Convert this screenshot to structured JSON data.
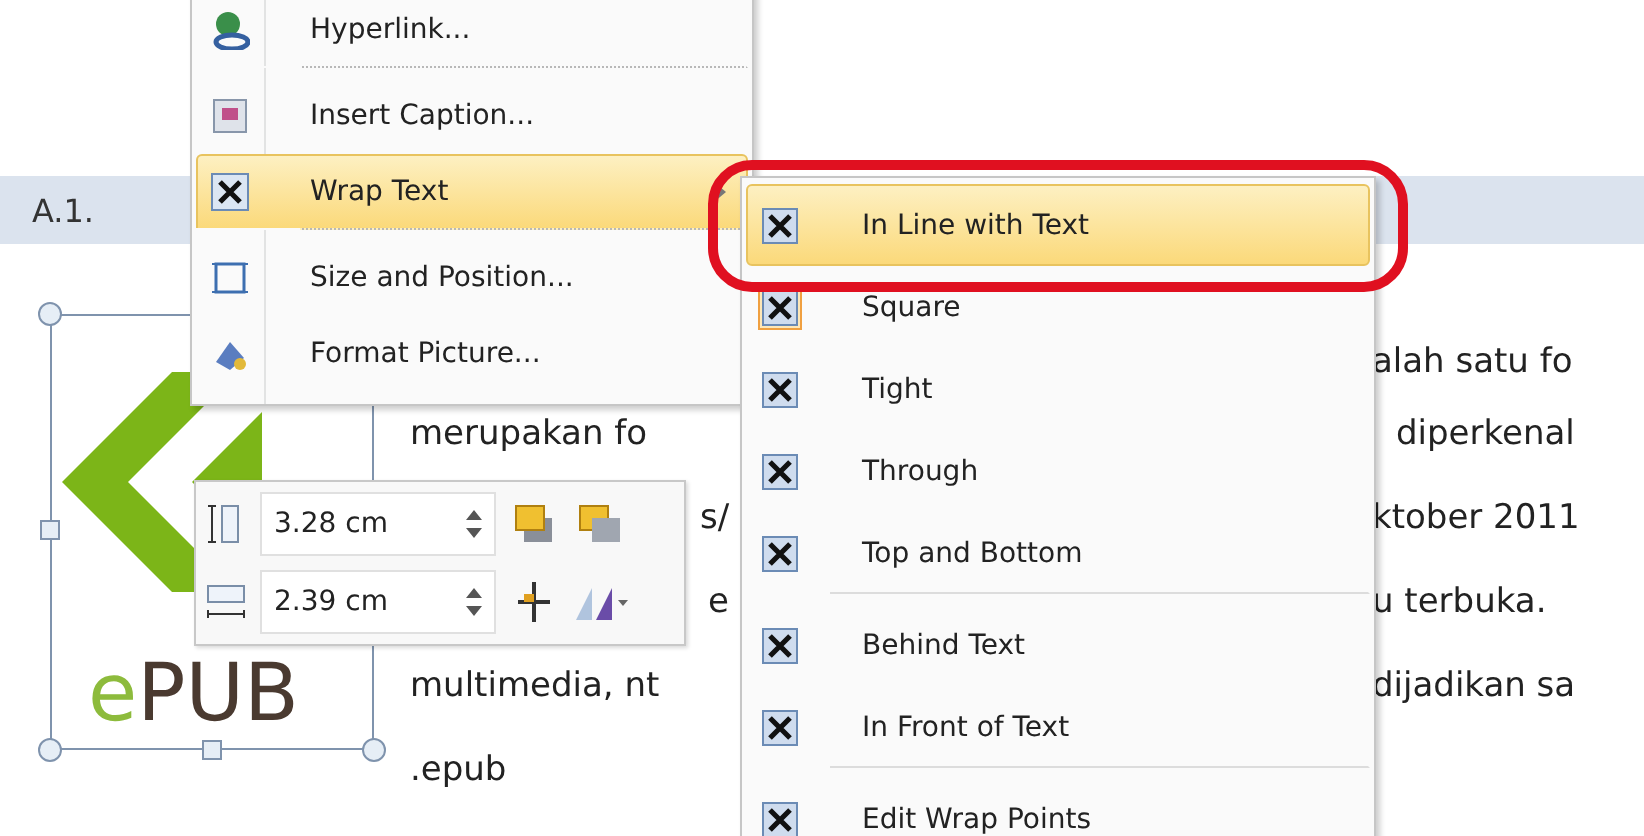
{
  "document": {
    "heading": "A.1.",
    "fragments": [
      {
        "text": "alah satu fo"
      },
      {
        "text": "merupakan fo"
      },
      {
        "text": "diperkenal"
      },
      {
        "text": "s/"
      },
      {
        "text": "ktober 2011"
      },
      {
        "text": "e"
      },
      {
        "text": "u terbuka."
      },
      {
        "text": "multimedia, nt"
      },
      {
        "text": "dijadikan sa"
      },
      {
        "text": ".epub"
      }
    ]
  },
  "picture": {
    "logo_text": "ePUB"
  },
  "context_menu": {
    "items": [
      {
        "label": "Hyperlink...",
        "selected": false,
        "submenu": false,
        "separator_after": true
      },
      {
        "label": "Insert Caption...",
        "selected": false,
        "submenu": false,
        "separator_after": false
      },
      {
        "label": "Wrap Text",
        "selected": true,
        "submenu": true,
        "separator_after": true
      },
      {
        "label": "Size and Position...",
        "selected": false,
        "submenu": false,
        "separator_after": false
      },
      {
        "label": "Format Picture...",
        "selected": false,
        "submenu": false,
        "separator_after": false
      }
    ]
  },
  "wrap_submenu": {
    "items": [
      {
        "label": "In Line with Text",
        "selected": true,
        "checked": false,
        "separator_after": false
      },
      {
        "label": "Square",
        "selected": false,
        "checked": true,
        "separator_after": false
      },
      {
        "label": "Tight",
        "selected": false,
        "checked": false,
        "separator_after": false
      },
      {
        "label": "Through",
        "selected": false,
        "checked": false,
        "separator_after": false
      },
      {
        "label": "Top and Bottom",
        "selected": false,
        "checked": false,
        "separator_after": true
      },
      {
        "label": "Behind Text",
        "selected": false,
        "checked": false,
        "separator_after": false
      },
      {
        "label": "In Front of Text",
        "selected": false,
        "checked": false,
        "separator_after": true
      },
      {
        "label": "Edit Wrap Points",
        "selected": false,
        "checked": false,
        "separator_after": false
      }
    ]
  },
  "mini_toolbar": {
    "height_value": "3.28 cm",
    "width_value": "2.39 cm"
  }
}
